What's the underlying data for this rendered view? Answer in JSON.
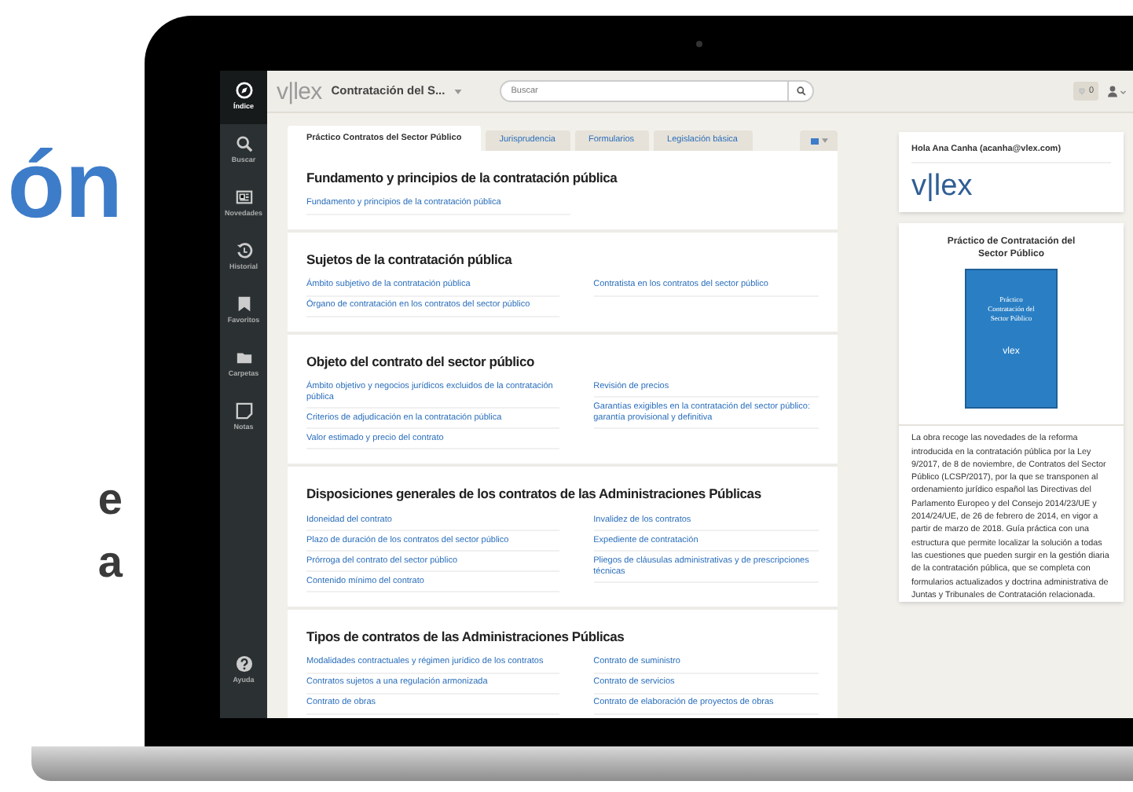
{
  "promo_text": [
    {
      "text": "ón",
      "kind": "headline"
    },
    {
      "text": "e",
      "kind": "body"
    },
    {
      "text": "a",
      "kind": "body"
    }
  ],
  "sidebar": {
    "items": [
      {
        "label": "Índice",
        "selected": true
      },
      {
        "label": "Buscar",
        "selected": false
      },
      {
        "label": "Novedades",
        "selected": false
      },
      {
        "label": "Historial",
        "selected": false
      },
      {
        "label": "Favoritos",
        "selected": false
      },
      {
        "label": "Carpetas",
        "selected": false
      },
      {
        "label": "Notas",
        "selected": false
      }
    ],
    "help": "Ayuda"
  },
  "topbar": {
    "logo": "v|lex",
    "title": "Contratación del S...",
    "search_placeholder": "Buscar",
    "badge": "0"
  },
  "tabs": [
    {
      "label": "Práctico Contratos del Sector Público",
      "selected": true
    },
    {
      "label": "Jurisprudencia",
      "selected": false
    },
    {
      "label": "Formularios",
      "selected": false
    },
    {
      "label": "Legislación básica",
      "selected": false
    }
  ],
  "sections": [
    {
      "title": "Fundamento y principios de la contratación pública",
      "left": [
        "Fundamento y principios de la contratación pública"
      ]
    },
    {
      "title": "Sujetos de la contratación pública",
      "left": [
        "Ámbito subjetivo de la contratación pública",
        "Órgano de contratación en los contratos del sector público"
      ],
      "right": [
        "Contratista en los contratos del sector público"
      ]
    },
    {
      "title": "Objeto del contrato del sector público",
      "left": [
        "Ámbito objetivo y negocios jurídicos excluidos de la contratación pública",
        "Criterios de adjudicación en la contratación pública",
        "Valor estimado y precio del contrato"
      ],
      "right": [
        "Revisión de precios",
        "Garantías exigibles en la contratación del sector público: garantía provisional y definitiva"
      ]
    },
    {
      "title": "Disposiciones generales de los contratos de las Administraciones Públicas",
      "left": [
        "Idoneidad del contrato",
        "Plazo de duración de los contratos del sector público",
        "Prórroga del contrato del sector público",
        "Contenido mínimo del contrato"
      ],
      "right": [
        "Invalidez de los contratos",
        "Expediente de contratación",
        "Pliegos de cláusulas administrativas y de prescripciones técnicas"
      ]
    },
    {
      "title": "Tipos de contratos de las Administraciones Públicas",
      "left": [
        "Modalidades contractuales y régimen jurídico de los contratos",
        "Contratos sujetos a una regulación armonizada",
        "Contrato de obras"
      ],
      "right": [
        "Contrato de suministro",
        "Contrato de servicios",
        "Contrato de elaboración de proyectos de obras"
      ]
    }
  ],
  "side_panel": {
    "greeting": "Hola Ana Canha (acanha@vlex.com)",
    "logo": "v|lex",
    "book_title": "Práctico de Contratación del Sector Público",
    "cover": {
      "title": "Práctico Contratación del Sector Público",
      "brand": "vlex"
    },
    "description": "La obra recoge las novedades de la reforma introducida en la contratación pública por la Ley 9/2017, de 8 de noviembre, de Contratos del Sector Público (LCSP/2017), por la que se transponen al ordenamiento jurídico español las Directivas del Parlamento Europeo y del Consejo 2014/23/UE y 2014/24/UE, de 26 de febrero de 2014, en vigor a partir de marzo de 2018. Guía práctica con una estructura que permite localizar la solución a todas las cuestiones que pueden surgir en la gestión diaria de la contratación pública, que se completa con formularios actualizados y doctrina administrativa de Juntas y Tribunales de Contratación relacionada."
  }
}
